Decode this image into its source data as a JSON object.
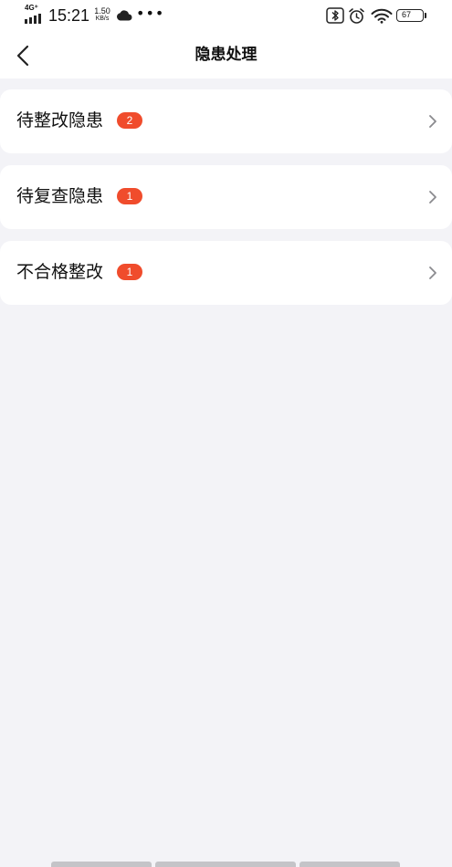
{
  "status_bar": {
    "network": "4G⁺",
    "time": "15:21",
    "speed_value": "1.50",
    "speed_unit": "KB/s",
    "more": "•••",
    "battery_level": "67",
    "icons": [
      "signal-icon",
      "cloud-icon",
      "bluetooth-icon",
      "alarm-icon",
      "wifi-icon",
      "battery-icon"
    ]
  },
  "header": {
    "title": "隐患处理",
    "back_icon": "chevron-left-icon"
  },
  "items": [
    {
      "label": "待整改隐患",
      "count": "2"
    },
    {
      "label": "待复查隐患",
      "count": "1"
    },
    {
      "label": "不合格整改",
      "count": "1"
    }
  ],
  "colors": {
    "badge": "#f04c2c",
    "background": "#f3f3f7",
    "card": "#ffffff"
  }
}
